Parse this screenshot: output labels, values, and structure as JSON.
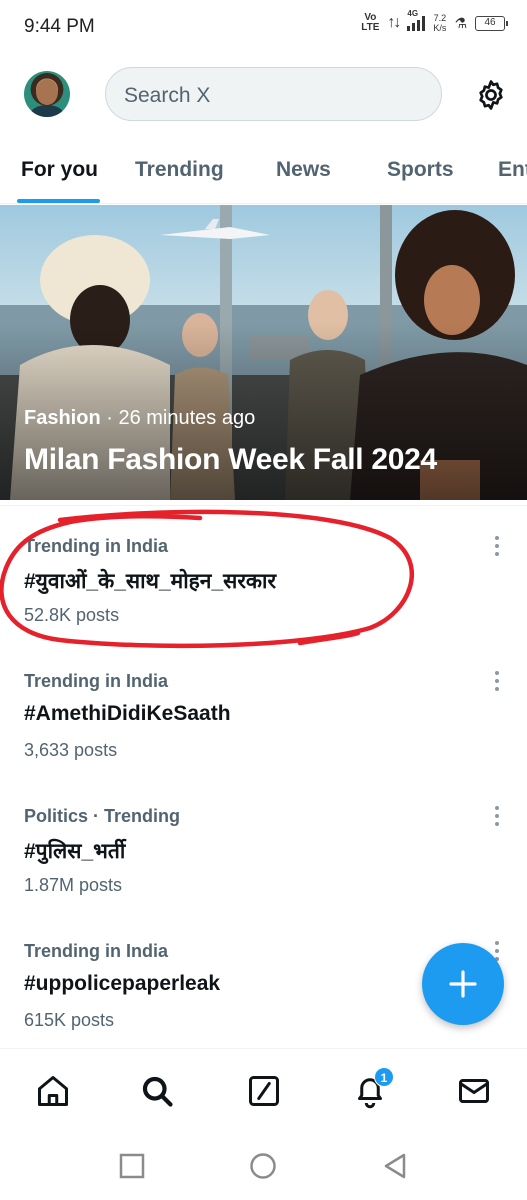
{
  "status_bar": {
    "time": "9:44 PM",
    "volte": "Vo\nLTE",
    "network": "4G",
    "speed_value": "7.2",
    "speed_unit": "K/s",
    "battery": "46"
  },
  "header": {
    "search_placeholder": "Search X",
    "avatar_icon": "profile-avatar",
    "settings_icon": "gear-icon"
  },
  "tabs": [
    {
      "label": "For you",
      "active": true
    },
    {
      "label": "Trending",
      "active": false
    },
    {
      "label": "News",
      "active": false
    },
    {
      "label": "Sports",
      "active": false
    },
    {
      "label": "Ent",
      "active": false
    }
  ],
  "hero": {
    "category": "Fashion",
    "separator": " · ",
    "time_ago": "26 minutes ago",
    "title": "Milan Fashion Week Fall 2024"
  },
  "trends": [
    {
      "context": "Trending in India",
      "name": "#युवाओं_के_साथ_मोहन_सरकार",
      "count": "52.8K posts"
    },
    {
      "context": "Trending in India",
      "name": "#AmethiDidiKeSaath",
      "count": "3,633 posts"
    },
    {
      "context": "Politics · Trending",
      "name": "#पुलिस_भर्ती",
      "count": "1.87M posts"
    },
    {
      "context": "Trending in India",
      "name": "#uppolicepaperleak",
      "count": "615K posts"
    }
  ],
  "bottom_nav": {
    "items": [
      "home-icon",
      "search-icon",
      "grok-icon",
      "notifications-icon",
      "messages-icon"
    ],
    "notification_count": "1"
  },
  "colors": {
    "accent": "#1d9bf0",
    "text_primary": "#0f1419",
    "text_secondary": "#536471",
    "annotation": "#e5222b"
  }
}
